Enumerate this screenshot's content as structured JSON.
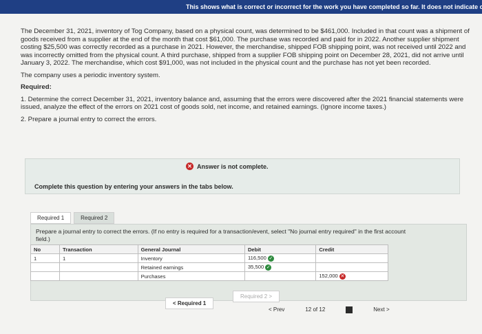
{
  "header": {
    "title": "This shows what is correct or incorrect for the work you have completed so far. It does not indicate co"
  },
  "problem": {
    "p1": "The December 31, 2021, inventory of Tog Company, based on a physical count, was determined to be $461,000. Included in that count was a shipment of goods received from a supplier at the end of the month that cost $61,000. The purchase was recorded and paid for in 2022. Another supplier shipment costing $25,500 was correctly recorded as a purchase in 2021. However, the merchandise, shipped FOB shipping point, was not received until 2022 and was incorrectly omitted from the physical count. A third purchase, shipped from a supplier FOB shipping point on December 28, 2021, did not arrive until January 3, 2022. The merchandise, which cost $91,000, was not included in the physical count and the purchase has not yet been recorded.",
    "p2": "The company uses a periodic inventory system.",
    "required_title": "Required:",
    "req1": "1. Determine the correct December 31, 2021, inventory balance and, assuming that the errors were discovered after the 2021 financial statements were issued, analyze the effect of the errors on 2021 cost of goods sold, net income, and retained earnings. (Ignore income taxes.)",
    "req2": "2. Prepare a journal entry to correct the errors."
  },
  "status": {
    "label": "Answer is not complete."
  },
  "instruction": "Complete this question by entering your answers in the tabs below.",
  "tabs": {
    "req1": "Required 1",
    "req2": "Required 2"
  },
  "tab_instruction": "Prepare a journal entry to correct the errors. (If no entry is required for a transaction/event, select \"No journal entry required\" in the first account field.)",
  "table": {
    "h_no": "No",
    "h_tr": "Transaction",
    "h_gj": "General Journal",
    "h_debit": "Debit",
    "h_credit": "Credit",
    "r1": {
      "no": "1",
      "tr": "1",
      "acct": "Inventory",
      "debit": "116,500",
      "credit": ""
    },
    "r2": {
      "no": "",
      "tr": "",
      "acct": "Retained earnings",
      "debit": "35,500",
      "credit": ""
    },
    "r3": {
      "no": "",
      "tr": "",
      "acct": "Purchases",
      "debit": "",
      "credit": "152,000"
    }
  },
  "nav": {
    "prev_tab": "Required 1",
    "next_tab": "Required 2",
    "prev": "Prev",
    "page": "12 of 12",
    "next": "Next"
  }
}
